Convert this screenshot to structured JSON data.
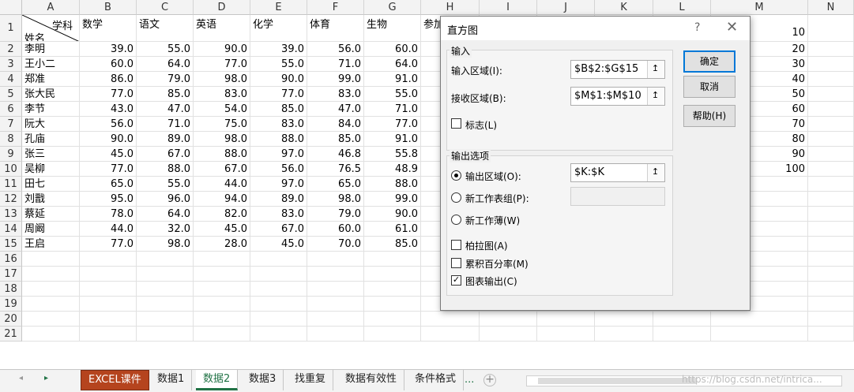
{
  "columns": [
    "A",
    "B",
    "C",
    "D",
    "E",
    "F",
    "G",
    "H",
    "I",
    "J",
    "K",
    "L",
    "M",
    "N"
  ],
  "rows": [
    "1",
    "2",
    "3",
    "4",
    "5",
    "6",
    "7",
    "8",
    "9",
    "10",
    "11",
    "12",
    "13",
    "14",
    "15",
    "16",
    "17",
    "18",
    "19",
    "20",
    "21"
  ],
  "corner_header": {
    "subject": "学科",
    "name": "姓名"
  },
  "subject_headers": [
    "数学",
    "语文",
    "英语",
    "化学",
    "体育",
    "生物",
    "参加"
  ],
  "students": [
    {
      "name": "李明",
      "scores": [
        "39.0",
        "55.0",
        "90.0",
        "39.0",
        "56.0",
        "60.0"
      ]
    },
    {
      "name": "王小二",
      "scores": [
        "60.0",
        "64.0",
        "77.0",
        "55.0",
        "71.0",
        "64.0"
      ]
    },
    {
      "name": "郑准",
      "scores": [
        "86.0",
        "79.0",
        "98.0",
        "90.0",
        "99.0",
        "91.0"
      ]
    },
    {
      "name": "张大民",
      "scores": [
        "77.0",
        "85.0",
        "83.0",
        "77.0",
        "83.0",
        "55.0"
      ]
    },
    {
      "name": "李节",
      "scores": [
        "43.0",
        "47.0",
        "54.0",
        "85.0",
        "47.0",
        "71.0"
      ]
    },
    {
      "name": "阮大",
      "scores": [
        "56.0",
        "71.0",
        "75.0",
        "83.0",
        "84.0",
        "77.0"
      ]
    },
    {
      "name": "孔庙",
      "scores": [
        "90.0",
        "89.0",
        "98.0",
        "88.0",
        "85.0",
        "91.0"
      ]
    },
    {
      "name": "张三",
      "scores": [
        "45.0",
        "67.0",
        "88.0",
        "97.0",
        "46.8",
        "55.8"
      ]
    },
    {
      "name": "吴柳",
      "scores": [
        "77.0",
        "88.0",
        "67.0",
        "56.0",
        "76.5",
        "48.9"
      ]
    },
    {
      "name": "田七",
      "scores": [
        "65.0",
        "55.0",
        "44.0",
        "97.0",
        "65.0",
        "88.0"
      ]
    },
    {
      "name": "刘戬",
      "scores": [
        "95.0",
        "96.0",
        "94.0",
        "89.0",
        "98.0",
        "99.0"
      ]
    },
    {
      "name": "蔡延",
      "scores": [
        "78.0",
        "64.0",
        "82.0",
        "83.0",
        "79.0",
        "90.0"
      ]
    },
    {
      "name": "周阚",
      "scores": [
        "44.0",
        "32.0",
        "45.0",
        "67.0",
        "60.0",
        "61.0"
      ]
    },
    {
      "name": "王启",
      "scores": [
        "77.0",
        "98.0",
        "28.0",
        "45.0",
        "70.0",
        "85.0"
      ]
    }
  ],
  "bins": [
    "10",
    "20",
    "30",
    "40",
    "50",
    "60",
    "70",
    "80",
    "90",
    "100"
  ],
  "dialog": {
    "title": "直方图",
    "help_icon": "?",
    "close_icon": "✕",
    "input_group": "输入",
    "input_range_label": "输入区域(I):",
    "input_range_value": "$B$2:$G$15",
    "bin_range_label": "接收区域(B):",
    "bin_range_value": "$M$1:$M$10",
    "labels_checkbox": "标志(L)",
    "output_group": "输出选项",
    "output_range_label": "输出区域(O):",
    "output_range_value": "$K:$K",
    "new_sheet_label": "新工作表组(P):",
    "new_workbook_label": "新工作薄(W)",
    "pareto_label": "柏拉图(A)",
    "cumulative_label": "累积百分率(M)",
    "chart_output_label": "图表输出(C)",
    "ok": "确定",
    "cancel": "取消",
    "help": "帮助(H)",
    "ref_icon": "↥"
  },
  "tabs": [
    "EXCEL课件",
    "数据1",
    "数据2",
    "数据3",
    "找重复",
    "数据有效性",
    "条件格式"
  ],
  "tab_more": "...",
  "tab_add": "+",
  "nav_prev": "◂",
  "nav_next": "▸",
  "watermark": "https://blog.csdn.net/intrica..."
}
